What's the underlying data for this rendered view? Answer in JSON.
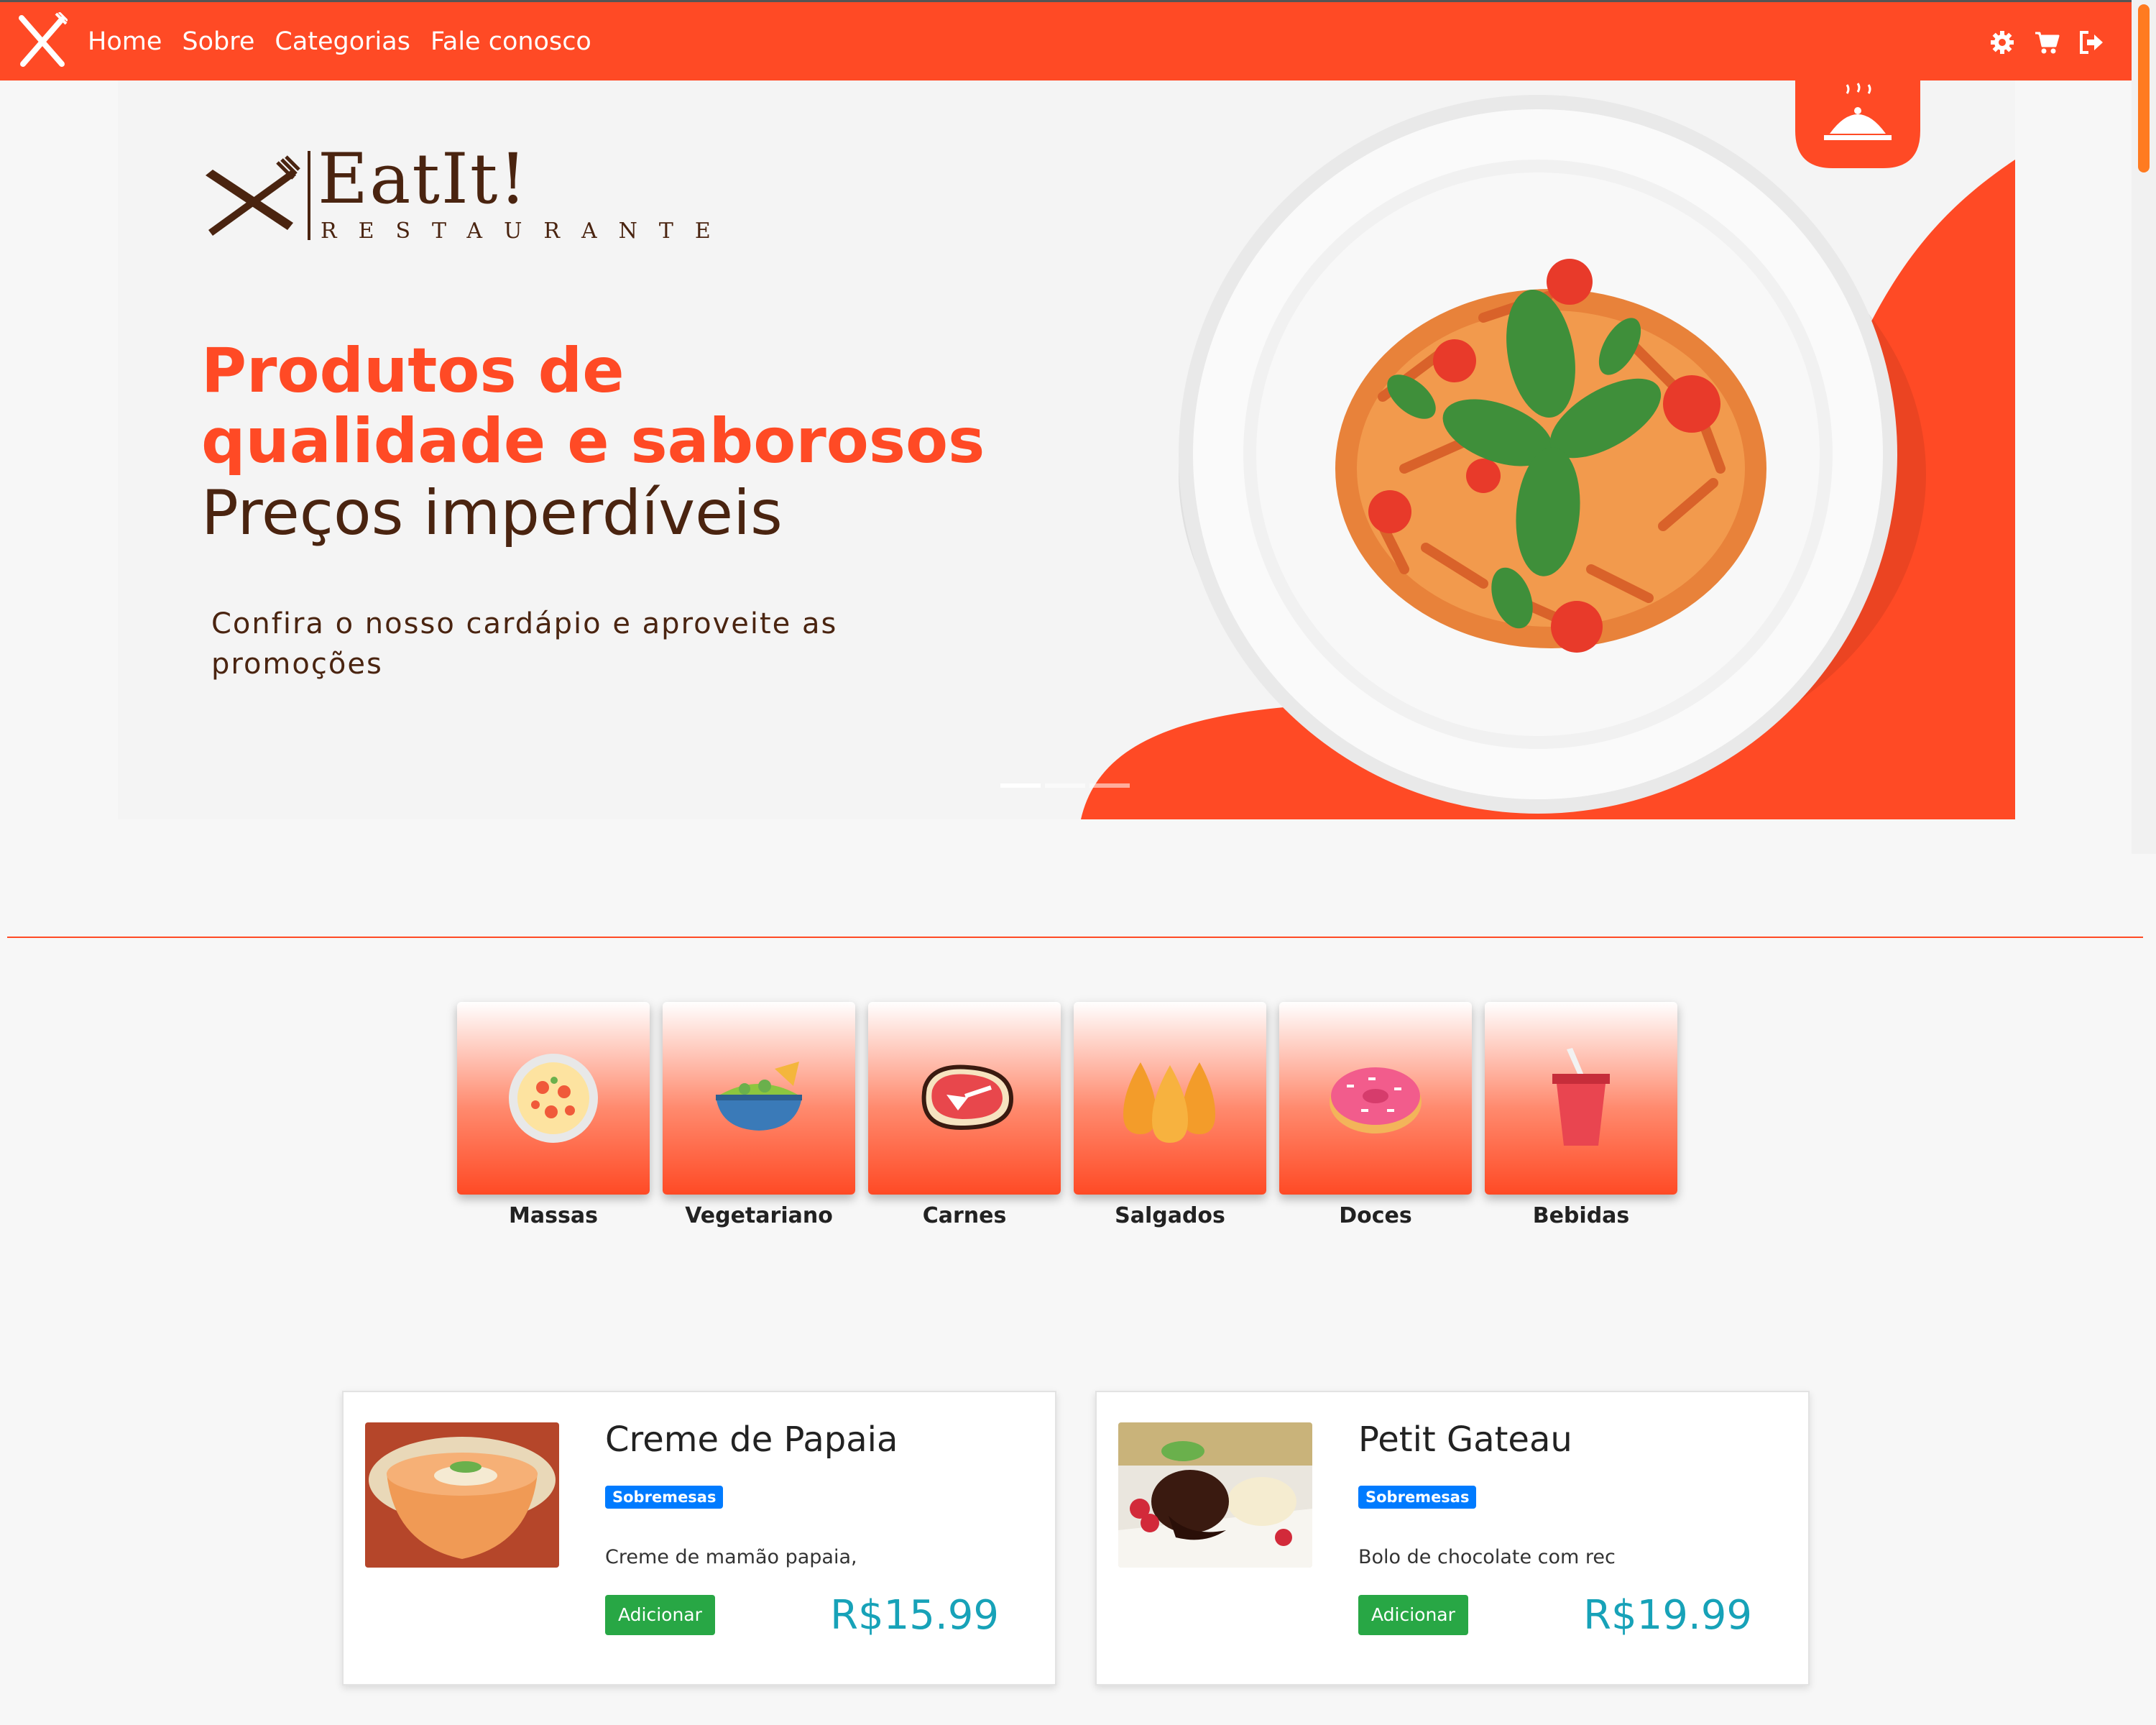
{
  "nav": {
    "links": [
      "Home",
      "Sobre",
      "Categorias",
      "Fale conosco"
    ],
    "icons": [
      "gear-icon",
      "cart-icon",
      "sign-out-icon"
    ]
  },
  "hero": {
    "brand_name": "EatIt!",
    "brand_sub": "RESTAURANTE",
    "headline_1": "Produtos de",
    "headline_2": "qualidade e saborosos",
    "headline_3": "Preços imperdíveis",
    "description": "Confira o nosso cardápio e aproveite as promoções",
    "slides_total": 3,
    "active_slide": 1
  },
  "categories": [
    {
      "label": "Massas",
      "icon": "pasta-plate-icon"
    },
    {
      "label": "Vegetariano",
      "icon": "salad-bowl-icon"
    },
    {
      "label": "Carnes",
      "icon": "steak-icon"
    },
    {
      "label": "Salgados",
      "icon": "coxinha-icon"
    },
    {
      "label": "Doces",
      "icon": "donut-icon"
    },
    {
      "label": "Bebidas",
      "icon": "drink-cup-icon"
    }
  ],
  "products": [
    {
      "title": "Creme de Papaia",
      "category": "Sobremesas",
      "description": "Creme de mamão papaia, sc",
      "button": "Adicionar",
      "price": "R$15.99"
    },
    {
      "title": "Petit Gateau",
      "category": "Sobremesas",
      "description": "Bolo de chocolate com rech",
      "button": "Adicionar",
      "price": "R$19.99"
    }
  ],
  "colors": {
    "brand": "#ff4a25",
    "brand_dark": "#4a2410",
    "badge": "#007bff",
    "button": "#28a745",
    "price": "#17a2b8"
  }
}
